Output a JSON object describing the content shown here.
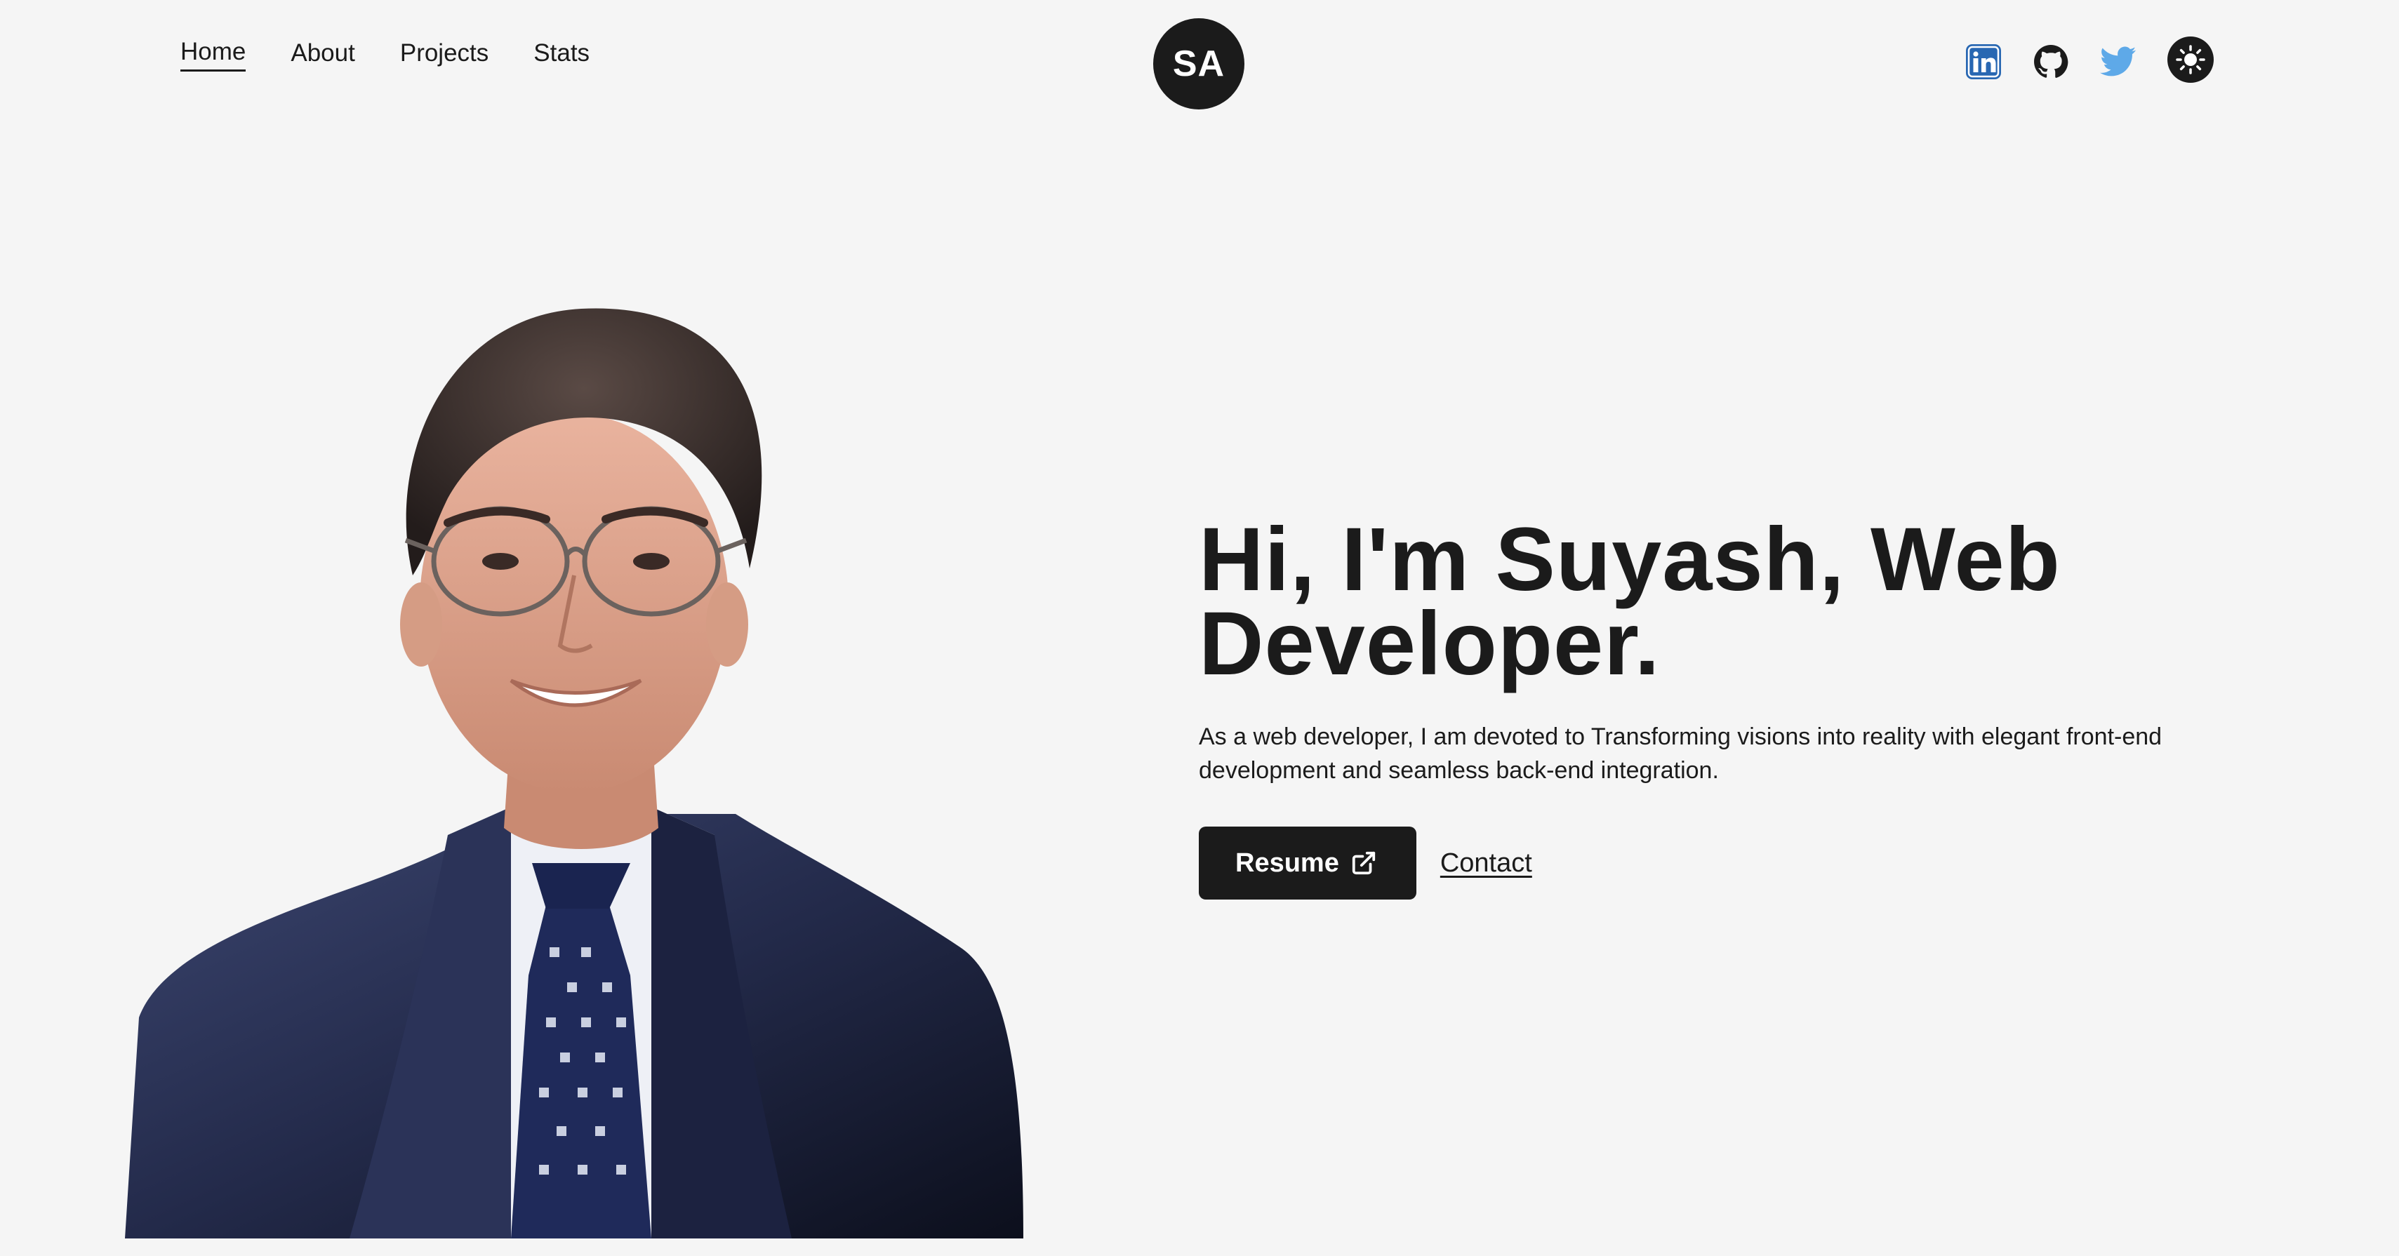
{
  "nav": {
    "items": [
      {
        "label": "Home",
        "active": true
      },
      {
        "label": "About",
        "active": false
      },
      {
        "label": "Projects",
        "active": false
      },
      {
        "label": "Stats",
        "active": false
      }
    ]
  },
  "logo": {
    "text": "SA"
  },
  "social": {
    "icons": [
      "linkedin-icon",
      "github-icon",
      "twitter-icon",
      "sun-icon"
    ],
    "colors": {
      "linkedin": "#2867b2",
      "github": "#1b1b1b",
      "twitter": "#5ea9e8"
    }
  },
  "hero": {
    "title": "Hi, I'm Suyash, Web Developer.",
    "description": "As a web developer, I am devoted to Transforming visions into reality with elegant front-end development and seamless back-end integration.",
    "resume_label": "Resume",
    "contact_label": "Contact"
  },
  "colors": {
    "background": "#f5f5f5",
    "text": "#1b1b1b",
    "button": "#1b1b1b"
  }
}
